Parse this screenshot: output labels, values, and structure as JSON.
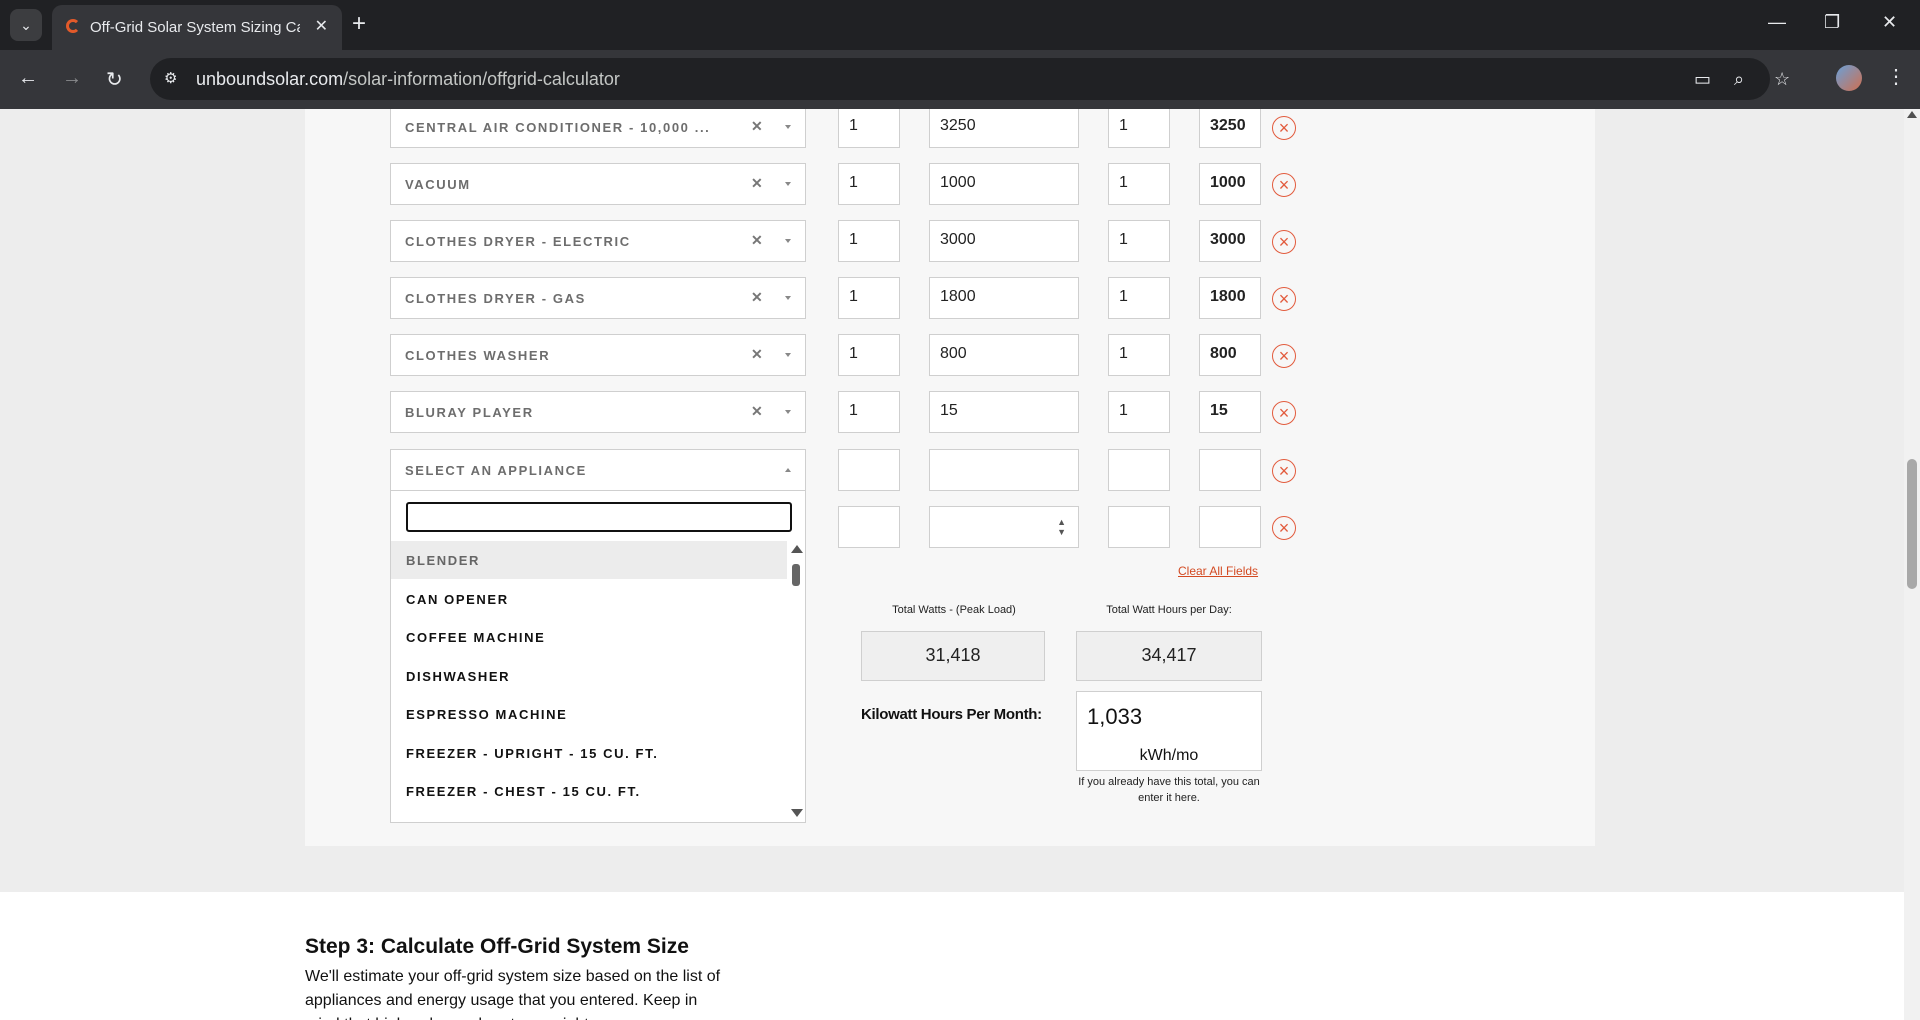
{
  "browser": {
    "tab_title": "Off-Grid Solar System Sizing Calculator",
    "url_domain": "unboundsolar.com",
    "url_path": "/solar-information/offgrid-calculator"
  },
  "rows": [
    {
      "appliance": "CENTRAL AIR CONDITIONER - 10,000 ...",
      "qty": "1",
      "watts": "3250",
      "hours": "1",
      "watt_hours": "3250"
    },
    {
      "appliance": "VACUUM",
      "qty": "1",
      "watts": "1000",
      "hours": "1",
      "watt_hours": "1000"
    },
    {
      "appliance": "CLOTHES DRYER - ELECTRIC",
      "qty": "1",
      "watts": "3000",
      "hours": "1",
      "watt_hours": "3000"
    },
    {
      "appliance": "CLOTHES DRYER - GAS",
      "qty": "1",
      "watts": "1800",
      "hours": "1",
      "watt_hours": "1800"
    },
    {
      "appliance": "CLOTHES WASHER",
      "qty": "1",
      "watts": "800",
      "hours": "1",
      "watt_hours": "800"
    },
    {
      "appliance": "BLURAY PLAYER",
      "qty": "1",
      "watts": "15",
      "hours": "1",
      "watt_hours": "15"
    }
  ],
  "select_placeholder": "SELECT AN APPLIANCE",
  "dropdown_options": [
    "BLENDER",
    "CAN OPENER",
    "COFFEE MACHINE",
    "DISHWASHER",
    "ESPRESSO MACHINE",
    "FREEZER - UPRIGHT - 15 CU. FT.",
    "FREEZER - CHEST - 15 CU. FT."
  ],
  "clear_all_label": "Clear All Fields",
  "totals": {
    "peak_label": "Total Watts - (Peak Load)",
    "peak_value": "31,418",
    "daily_label": "Total Watt Hours per Day:",
    "daily_value": "34,417",
    "kwh_label": "Kilowatt Hours Per Month:",
    "kwh_value": "1,033",
    "kwh_unit": "kWh/mo",
    "kwh_note": "If you already have this total, you can enter it here."
  },
  "step3": {
    "title": "Step 3: Calculate Off-Grid System Size",
    "body": "We'll estimate your off-grid system size based on the list of appliances and energy usage that you entered. Keep in mind that higher demand systems might"
  },
  "colors": {
    "accent": "#e25b3d",
    "link": "#d34a22"
  }
}
